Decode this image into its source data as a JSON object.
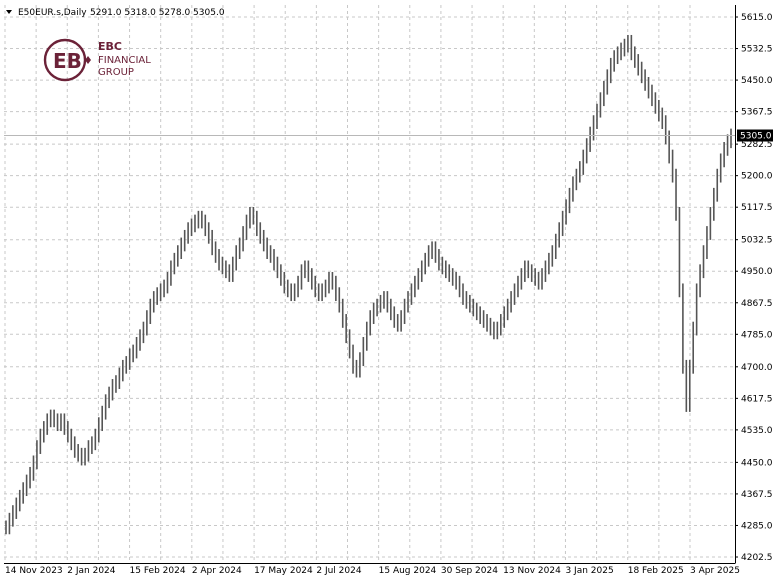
{
  "header": {
    "symbol": "E50EUR.s,Daily",
    "ohlc": "5291.0 5318.0 5278.0 5305.0"
  },
  "logo": {
    "line1": "EBC",
    "line2": "FINANCIAL",
    "line3": "GROUP",
    "color": "#6b2238"
  },
  "chart_data": {
    "type": "ohlc",
    "title": "",
    "xlabel": "",
    "ylabel": "",
    "ylim": [
      4202.5,
      5615.0
    ],
    "y_ticks": [
      "5615.0",
      "5532.5",
      "5450.0",
      "5367.5",
      "5282.5",
      "5200.0",
      "5117.5",
      "5032.5",
      "4950.0",
      "4867.5",
      "4785.0",
      "4700.0",
      "4617.5",
      "4535.0",
      "4450.0",
      "4367.5",
      "4285.0",
      "4202.5"
    ],
    "x_ticks": [
      "14 Nov 2023",
      "2 Jan 2024",
      "15 Feb 2024",
      "2 Apr 2024",
      "17 May 2024",
      "2 Jul 2024",
      "15 Aug 2024",
      "30 Sep 2024",
      "13 Nov 2024",
      "3 Jan 2025",
      "18 Feb 2025",
      "3 Apr 2025"
    ],
    "grid": true,
    "last_price": 5305.0,
    "last_price_label": "5305.0",
    "series": [
      {
        "values": [
          4280,
          4300,
          4320,
          4340,
          4360,
          4380,
          4400,
          4420,
          4450,
          4490,
          4520,
          4540,
          4560,
          4570,
          4560,
          4550,
          4560,
          4540,
          4520,
          4500,
          4480,
          4470,
          4460,
          4470,
          4490,
          4500,
          4520,
          4550,
          4580,
          4610,
          4630,
          4650,
          4660,
          4680,
          4700,
          4710,
          4730,
          4740,
          4760,
          4780,
          4800,
          4830,
          4860,
          4880,
          4890,
          4900,
          4910,
          4930,
          4960,
          4980,
          5000,
          5020,
          5040,
          5060,
          5070,
          5080,
          5090,
          5080,
          5060,
          5040,
          5010,
          4990,
          4970,
          4960,
          4950,
          4940,
          4970,
          5000,
          5020,
          5050,
          5080,
          5100,
          5090,
          5060,
          5040,
          5020,
          5000,
          4990,
          4970,
          4950,
          4930,
          4910,
          4900,
          4890,
          4900,
          4920,
          4950,
          4960,
          4940,
          4920,
          4900,
          4890,
          4900,
          4910,
          4930,
          4920,
          4890,
          4860,
          4820,
          4780,
          4740,
          4700,
          4690,
          4720,
          4760,
          4800,
          4830,
          4850,
          4860,
          4870,
          4880,
          4860,
          4840,
          4820,
          4810,
          4830,
          4860,
          4880,
          4900,
          4920,
          4940,
          4960,
          4980,
          5000,
          5010,
          4990,
          4970,
          4960,
          4950,
          4940,
          4930,
          4920,
          4900,
          4880,
          4870,
          4860,
          4850,
          4840,
          4830,
          4820,
          4810,
          4800,
          4790,
          4800,
          4820,
          4840,
          4860,
          4880,
          4900,
          4920,
          4940,
          4960,
          4950,
          4940,
          4930,
          4920,
          4940,
          4960,
          4980,
          5000,
          5030,
          5060,
          5090,
          5120,
          5150,
          5180,
          5200,
          5220,
          5250,
          5280,
          5310,
          5340,
          5370,
          5400,
          5430,
          5460,
          5490,
          5510,
          5520,
          5530,
          5540,
          5550,
          5520,
          5500,
          5480,
          5460,
          5440,
          5420,
          5400,
          5380,
          5360,
          5340,
          5300,
          5250,
          5200,
          5100,
          4900,
          4700,
          4600,
          4700,
          4800,
          4900,
          4950,
          5000,
          5050,
          5100,
          5150,
          5200,
          5240,
          5270,
          5290,
          5305
        ]
      }
    ]
  }
}
